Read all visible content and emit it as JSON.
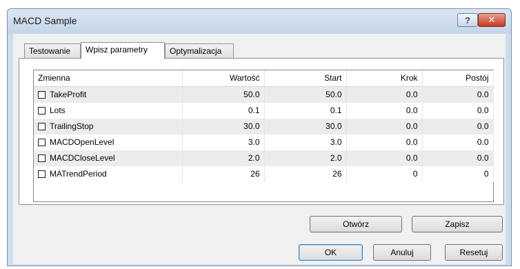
{
  "window": {
    "title": "MACD Sample",
    "help_label": "?",
    "close_label": "✕"
  },
  "tabs": [
    {
      "label": "Testowanie",
      "active": false
    },
    {
      "label": "Wpisz parametry",
      "active": true
    },
    {
      "label": "Optymalizacja",
      "active": false
    }
  ],
  "table": {
    "columns": [
      "Zmienna",
      "Wartość",
      "Start",
      "Krok",
      "Postój"
    ],
    "rows": [
      {
        "name": "TakeProfit",
        "checked": false,
        "value": "50.0",
        "start": "50.0",
        "step": "0.0",
        "stop": "0.0"
      },
      {
        "name": "Lots",
        "checked": false,
        "value": "0.1",
        "start": "0.1",
        "step": "0.0",
        "stop": "0.0"
      },
      {
        "name": "TrailingStop",
        "checked": false,
        "value": "30.0",
        "start": "30.0",
        "step": "0.0",
        "stop": "0.0"
      },
      {
        "name": "MACDOpenLevel",
        "checked": false,
        "value": "3.0",
        "start": "3.0",
        "step": "0.0",
        "stop": "0.0"
      },
      {
        "name": "MACDCloseLevel",
        "checked": false,
        "value": "2.0",
        "start": "2.0",
        "step": "0.0",
        "stop": "0.0"
      },
      {
        "name": "MATrendPeriod",
        "checked": false,
        "value": "26",
        "start": "26",
        "step": "0",
        "stop": "0"
      }
    ]
  },
  "buttons": {
    "open_label": "Otwórz",
    "save_label": "Zapisz",
    "ok_label": "OK",
    "cancel_label": "Anuluj",
    "reset_label": "Resetuj"
  }
}
